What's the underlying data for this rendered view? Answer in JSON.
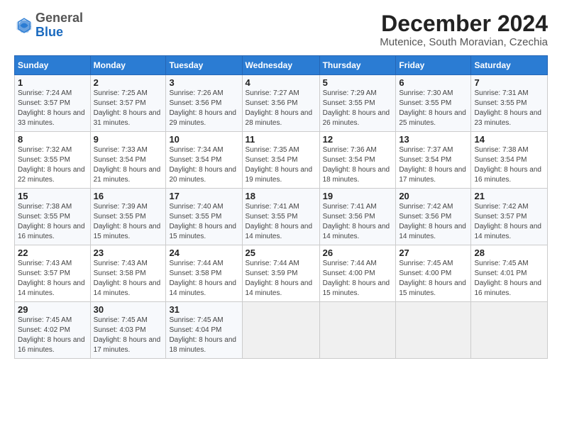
{
  "header": {
    "logo_general": "General",
    "logo_blue": "Blue",
    "title": "December 2024",
    "subtitle": "Mutenice, South Moravian, Czechia"
  },
  "weekdays": [
    "Sunday",
    "Monday",
    "Tuesday",
    "Wednesday",
    "Thursday",
    "Friday",
    "Saturday"
  ],
  "weeks": [
    [
      {
        "day": 1,
        "sunrise": "7:24 AM",
        "sunset": "3:57 PM",
        "daylight": "8 hours and 33 minutes."
      },
      {
        "day": 2,
        "sunrise": "7:25 AM",
        "sunset": "3:57 PM",
        "daylight": "8 hours and 31 minutes."
      },
      {
        "day": 3,
        "sunrise": "7:26 AM",
        "sunset": "3:56 PM",
        "daylight": "8 hours and 29 minutes."
      },
      {
        "day": 4,
        "sunrise": "7:27 AM",
        "sunset": "3:56 PM",
        "daylight": "8 hours and 28 minutes."
      },
      {
        "day": 5,
        "sunrise": "7:29 AM",
        "sunset": "3:55 PM",
        "daylight": "8 hours and 26 minutes."
      },
      {
        "day": 6,
        "sunrise": "7:30 AM",
        "sunset": "3:55 PM",
        "daylight": "8 hours and 25 minutes."
      },
      {
        "day": 7,
        "sunrise": "7:31 AM",
        "sunset": "3:55 PM",
        "daylight": "8 hours and 23 minutes."
      }
    ],
    [
      {
        "day": 8,
        "sunrise": "7:32 AM",
        "sunset": "3:55 PM",
        "daylight": "8 hours and 22 minutes."
      },
      {
        "day": 9,
        "sunrise": "7:33 AM",
        "sunset": "3:54 PM",
        "daylight": "8 hours and 21 minutes."
      },
      {
        "day": 10,
        "sunrise": "7:34 AM",
        "sunset": "3:54 PM",
        "daylight": "8 hours and 20 minutes."
      },
      {
        "day": 11,
        "sunrise": "7:35 AM",
        "sunset": "3:54 PM",
        "daylight": "8 hours and 19 minutes."
      },
      {
        "day": 12,
        "sunrise": "7:36 AM",
        "sunset": "3:54 PM",
        "daylight": "8 hours and 18 minutes."
      },
      {
        "day": 13,
        "sunrise": "7:37 AM",
        "sunset": "3:54 PM",
        "daylight": "8 hours and 17 minutes."
      },
      {
        "day": 14,
        "sunrise": "7:38 AM",
        "sunset": "3:54 PM",
        "daylight": "8 hours and 16 minutes."
      }
    ],
    [
      {
        "day": 15,
        "sunrise": "7:38 AM",
        "sunset": "3:55 PM",
        "daylight": "8 hours and 16 minutes."
      },
      {
        "day": 16,
        "sunrise": "7:39 AM",
        "sunset": "3:55 PM",
        "daylight": "8 hours and 15 minutes."
      },
      {
        "day": 17,
        "sunrise": "7:40 AM",
        "sunset": "3:55 PM",
        "daylight": "8 hours and 15 minutes."
      },
      {
        "day": 18,
        "sunrise": "7:41 AM",
        "sunset": "3:55 PM",
        "daylight": "8 hours and 14 minutes."
      },
      {
        "day": 19,
        "sunrise": "7:41 AM",
        "sunset": "3:56 PM",
        "daylight": "8 hours and 14 minutes."
      },
      {
        "day": 20,
        "sunrise": "7:42 AM",
        "sunset": "3:56 PM",
        "daylight": "8 hours and 14 minutes."
      },
      {
        "day": 21,
        "sunrise": "7:42 AM",
        "sunset": "3:57 PM",
        "daylight": "8 hours and 14 minutes."
      }
    ],
    [
      {
        "day": 22,
        "sunrise": "7:43 AM",
        "sunset": "3:57 PM",
        "daylight": "8 hours and 14 minutes."
      },
      {
        "day": 23,
        "sunrise": "7:43 AM",
        "sunset": "3:58 PM",
        "daylight": "8 hours and 14 minutes."
      },
      {
        "day": 24,
        "sunrise": "7:44 AM",
        "sunset": "3:58 PM",
        "daylight": "8 hours and 14 minutes."
      },
      {
        "day": 25,
        "sunrise": "7:44 AM",
        "sunset": "3:59 PM",
        "daylight": "8 hours and 14 minutes."
      },
      {
        "day": 26,
        "sunrise": "7:44 AM",
        "sunset": "4:00 PM",
        "daylight": "8 hours and 15 minutes."
      },
      {
        "day": 27,
        "sunrise": "7:45 AM",
        "sunset": "4:00 PM",
        "daylight": "8 hours and 15 minutes."
      },
      {
        "day": 28,
        "sunrise": "7:45 AM",
        "sunset": "4:01 PM",
        "daylight": "8 hours and 16 minutes."
      }
    ],
    [
      {
        "day": 29,
        "sunrise": "7:45 AM",
        "sunset": "4:02 PM",
        "daylight": "8 hours and 16 minutes."
      },
      {
        "day": 30,
        "sunrise": "7:45 AM",
        "sunset": "4:03 PM",
        "daylight": "8 hours and 17 minutes."
      },
      {
        "day": 31,
        "sunrise": "7:45 AM",
        "sunset": "4:04 PM",
        "daylight": "8 hours and 18 minutes."
      },
      null,
      null,
      null,
      null
    ]
  ],
  "labels": {
    "sunrise": "Sunrise:",
    "sunset": "Sunset:",
    "daylight": "Daylight:"
  }
}
